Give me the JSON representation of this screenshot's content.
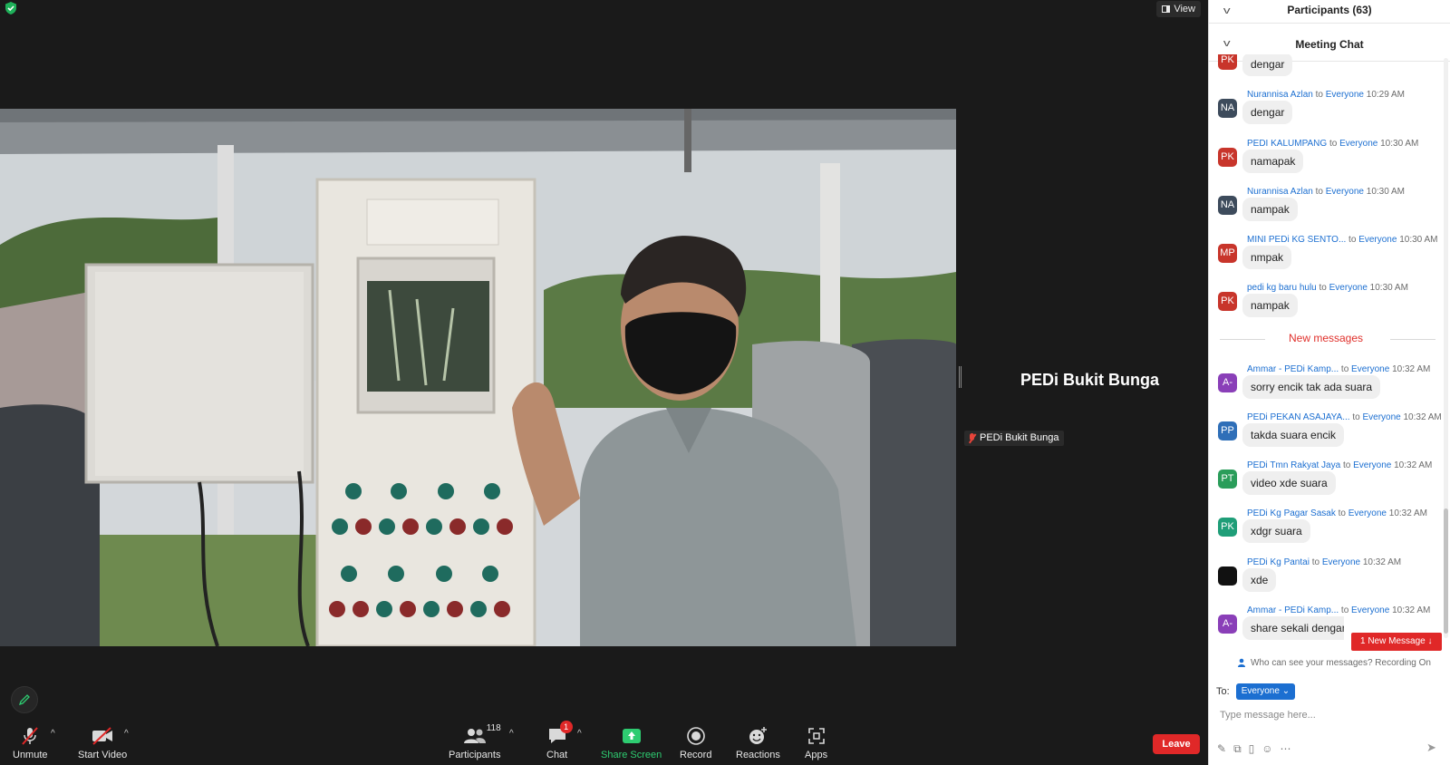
{
  "top": {
    "view_label": "View"
  },
  "stage": {
    "speaker_name": "PEDi Bukit Bunga",
    "name_tag": "PEDi Bukit Bunga"
  },
  "toolbar": {
    "unmute": "Unmute",
    "start_video": "Start Video",
    "participants": "Participants",
    "participants_count": "118",
    "chat": "Chat",
    "chat_badge": "1",
    "share_screen": "Share Screen",
    "record": "Record",
    "reactions": "Reactions",
    "apps": "Apps",
    "leave": "Leave"
  },
  "panel": {
    "participants_title": "Participants (63)",
    "chat_title": "Meeting Chat",
    "new_messages": "New messages",
    "new_message_pill": "1 New Message ↓",
    "who_can_see": "Who can see your messages? Recording On",
    "to_label": "To:",
    "to_value": "Everyone",
    "input_placeholder": "Type message here..."
  },
  "colors": {
    "accent_blue": "#1c6fd1",
    "leave_red": "#e02828",
    "share_green": "#2ecc71"
  },
  "messages": [
    {
      "initials": "PK",
      "color": "#c8352b",
      "sender": "",
      "to": "",
      "time": "",
      "text": "dengar"
    },
    {
      "initials": "NA",
      "color": "#3d4b5c",
      "sender": "Nurannisa Azlan",
      "to": "Everyone",
      "time": "10:29 AM",
      "text": "dengar"
    },
    {
      "initials": "PK",
      "color": "#c8352b",
      "sender": "PEDI KALUMPANG",
      "to": "Everyone",
      "time": "10:30 AM",
      "text": "namapak"
    },
    {
      "initials": "NA",
      "color": "#3d4b5c",
      "sender": "Nurannisa Azlan",
      "to": "Everyone",
      "time": "10:30 AM",
      "text": "nampak"
    },
    {
      "initials": "MP",
      "color": "#c8352b",
      "sender": "MINI PEDi KG SENTO...",
      "to": "Everyone",
      "time": "10:30 AM",
      "text": "nmpak"
    },
    {
      "initials": "PK",
      "color": "#c8352b",
      "sender": "pedi kg baru hulu",
      "to": "Everyone",
      "time": "10:30 AM",
      "text": "nampak"
    },
    {
      "initials": "A-",
      "color": "#8a3fb8",
      "sender": "Ammar - PEDi Kamp...",
      "to": "Everyone",
      "time": "10:32 AM",
      "text": "sorry encik tak ada suara"
    },
    {
      "initials": "PP",
      "color": "#2f6fb8",
      "sender": "PEDi PEKAN ASAJAYA...",
      "to": "Everyone",
      "time": "10:32 AM",
      "text": "takda suara encik"
    },
    {
      "initials": "PT",
      "color": "#2a9d5a",
      "sender": "PEDi Tmn Rakyat Jaya",
      "to": "Everyone",
      "time": "10:32 AM",
      "text": "video xde suara"
    },
    {
      "initials": "PK",
      "color": "#1f9e78",
      "sender": "PEDi Kg Pagar Sasak",
      "to": "Everyone",
      "time": "10:32 AM",
      "text": "xdgr suara"
    },
    {
      "initials": "",
      "color": "#111111",
      "sender": "PEDi Kg Pantai",
      "to": "Everyone",
      "time": "10:32 AM",
      "text": "xde"
    },
    {
      "initials": "A-",
      "color": "#8a3fb8",
      "sender": "Ammar - PEDi Kamp...",
      "to": "Everyone",
      "time": "10:32 AM",
      "text": "share sekali dengan a"
    }
  ]
}
